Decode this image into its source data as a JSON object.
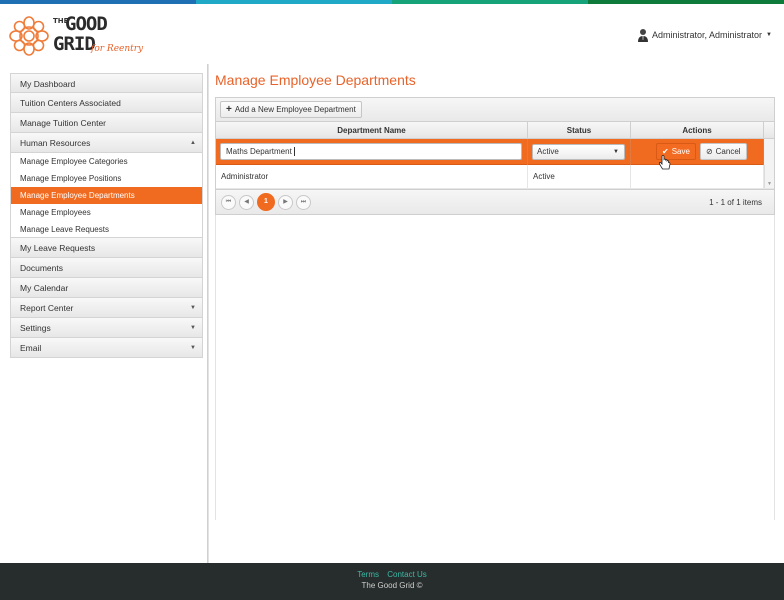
{
  "colors": {
    "stripe": [
      "#1f6fb5",
      "#1fa9c6",
      "#17a37a",
      "#0f7b3b"
    ],
    "accent": "#f06a1f",
    "title": "#e8632a",
    "footer_bg": "#272c2c",
    "footer_link": "#3db9a6"
  },
  "logo": {
    "the": "THE",
    "good": "GOOD",
    "grid": "GRID",
    "tagline": "for Reentry"
  },
  "user": {
    "name": "Administrator, Administrator",
    "icon": "user-avatar-icon"
  },
  "sidebar": {
    "items": [
      {
        "label": "My Dashboard"
      },
      {
        "label": "Tuition Centers Associated"
      },
      {
        "label": "Manage Tuition Center"
      },
      {
        "label": "Human Resources",
        "caret": "▲"
      }
    ],
    "sub_items": [
      {
        "label": "Manage Employee Categories"
      },
      {
        "label": "Manage Employee Positions"
      },
      {
        "label": "Manage Employee Departments"
      },
      {
        "label": "Manage Employees"
      },
      {
        "label": "Manage Leave Requests"
      }
    ],
    "bottom_items": [
      {
        "label": "My Leave Requests"
      },
      {
        "label": "Documents"
      },
      {
        "label": "My Calendar"
      },
      {
        "label": "Report Center",
        "caret": "▼"
      },
      {
        "label": "Settings",
        "caret": "▼"
      },
      {
        "label": "Email",
        "caret": "▼"
      }
    ]
  },
  "main": {
    "title": "Manage Employee Departments",
    "add_button": "Add a New Employee Department",
    "columns": [
      "Department Name",
      "Status",
      "Actions"
    ],
    "edit_row": {
      "name_value": "Maths Department",
      "status_value": "Active",
      "save_label": "Save",
      "cancel_label": "Cancel"
    },
    "rows": [
      {
        "name": "Administrator",
        "status": "Active"
      }
    ],
    "pager": {
      "current_page": "1",
      "info": "1 - 1 of 1 items"
    }
  },
  "footer": {
    "terms": "Terms",
    "contact": "Contact Us",
    "copyright": "The Good Grid ©"
  }
}
